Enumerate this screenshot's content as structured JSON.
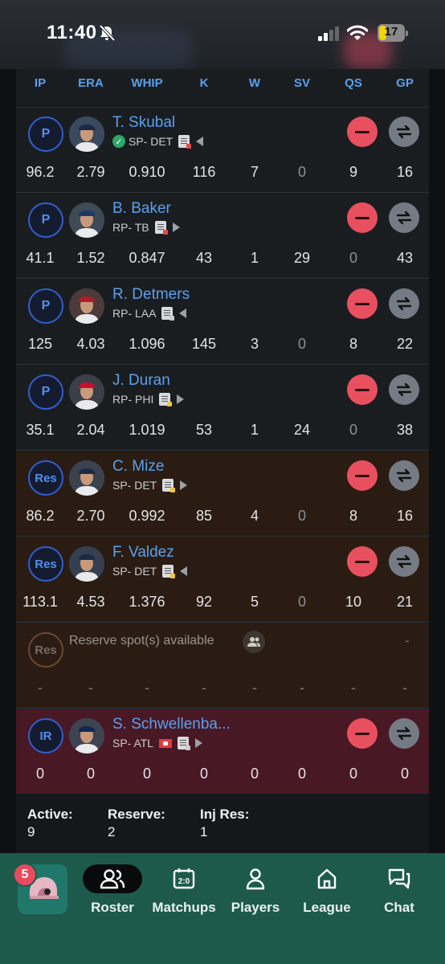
{
  "status_bar": {
    "time": "11:40",
    "battery": "17"
  },
  "columns": [
    "IP",
    "ERA",
    "WHIP",
    "K",
    "W",
    "SV",
    "QS",
    "GP"
  ],
  "players": [
    {
      "pos": "P",
      "slot": "active",
      "name": "T. Skubal",
      "info": "SP- DET",
      "healthy": true,
      "note_color": "#e24a4a",
      "arrow": "left",
      "stats": [
        "96.2",
        "2.79",
        "0.910",
        "116",
        "7",
        "0",
        "9",
        "16"
      ],
      "dim_stats": [
        5
      ]
    },
    {
      "pos": "P",
      "slot": "active",
      "name": "B. Baker",
      "info": "RP- TB",
      "note_color": "#e24a4a",
      "arrow": "right",
      "stats": [
        "41.1",
        "1.52",
        "0.847",
        "43",
        "1",
        "29",
        "0",
        "43"
      ],
      "dim_stats": [
        6
      ]
    },
    {
      "pos": "P",
      "slot": "active",
      "name": "R. Detmers",
      "info": "RP- LAA",
      "note_color": "#c9ccd0",
      "arrow": "left",
      "stats": [
        "125",
        "4.03",
        "1.096",
        "145",
        "3",
        "0",
        "8",
        "22"
      ],
      "dim_stats": [
        5
      ]
    },
    {
      "pos": "P",
      "slot": "active",
      "name": "J. Duran",
      "info": "RP- PHI",
      "note_color": "#f0c63a",
      "arrow": "right",
      "stats": [
        "35.1",
        "2.04",
        "1.019",
        "53",
        "1",
        "24",
        "0",
        "38"
      ],
      "dim_stats": [
        6
      ]
    },
    {
      "pos": "Res",
      "slot": "reserve",
      "name": "C. Mize",
      "info": "SP- DET",
      "note_color": "#f0c63a",
      "arrow": "right",
      "stats": [
        "86.2",
        "2.70",
        "0.992",
        "85",
        "4",
        "0",
        "8",
        "16"
      ],
      "dim_stats": [
        5
      ]
    },
    {
      "pos": "Res",
      "slot": "reserve",
      "name": "F. Valdez",
      "info": "SP- DET",
      "note_color": "#f0c63a",
      "arrow": "left",
      "stats": [
        "113.1",
        "4.53",
        "1.376",
        "92",
        "5",
        "0",
        "10",
        "21"
      ],
      "dim_stats": [
        5
      ]
    }
  ],
  "reserve_empty": {
    "pos": "Res",
    "message": "Reserve spot(s) available",
    "dash": "-",
    "stats": [
      "-",
      "-",
      "-",
      "-",
      "-",
      "-",
      "-",
      "-"
    ]
  },
  "ir_player": {
    "pos": "IR",
    "name": "S. Schwellenba...",
    "info": "SP- ATL",
    "note_color": "#c9ccd0",
    "arrow": "right",
    "stats": [
      "0",
      "0",
      "0",
      "0",
      "0",
      "0",
      "0",
      "0"
    ]
  },
  "summary": {
    "active_label": "Active:",
    "active_value": "9",
    "reserve_label": "Reserve:",
    "reserve_value": "2",
    "injres_label": "Inj Res:",
    "injres_value": "1"
  },
  "nav": {
    "badge": "5",
    "items": [
      {
        "label": "Roster",
        "icon": "people-icon",
        "selected": true
      },
      {
        "label": "Matchups",
        "icon": "scoreboard-icon"
      },
      {
        "label": "Players",
        "icon": "person-icon"
      },
      {
        "label": "League",
        "icon": "home-icon"
      },
      {
        "label": "Chat",
        "icon": "chat-icon"
      }
    ]
  },
  "colors": {
    "accent": "#5aa0ee",
    "drop": "#e8505f",
    "reserve_bg": "#2a1c12",
    "ir_bg": "#481824",
    "nav_bg": "#1d5a4c"
  }
}
